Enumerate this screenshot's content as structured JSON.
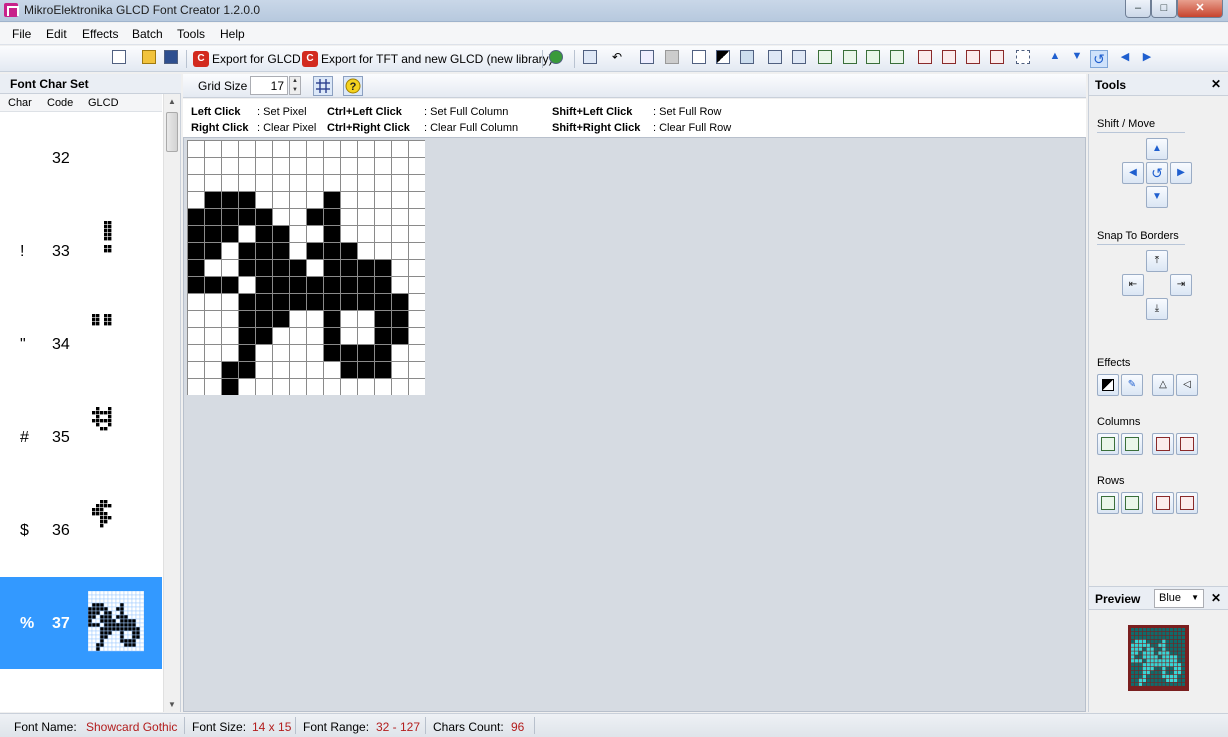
{
  "window": {
    "title": "MikroElektronika GLCD Font Creator 1.2.0.0"
  },
  "menu": {
    "items": [
      "File",
      "Edit",
      "Effects",
      "Batch",
      "Tools",
      "Help"
    ]
  },
  "toolbar": {
    "export_glcd": "Export for GLCD",
    "export_tft": "Export for TFT and new GLCD (new library)"
  },
  "charset": {
    "title": "Font Char Set",
    "col_char": "Char",
    "col_code": "Code",
    "col_glcd": "GLCD",
    "rows": [
      {
        "char": "",
        "code": "32"
      },
      {
        "char": "!",
        "code": "33"
      },
      {
        "char": "\"",
        "code": "34"
      },
      {
        "char": "#",
        "code": "35"
      },
      {
        "char": "$",
        "code": "36"
      },
      {
        "char": "%",
        "code": "37"
      }
    ],
    "selected_code": "37"
  },
  "gridbar": {
    "label": "Grid Size",
    "value": "17"
  },
  "hints": [
    {
      "key": "Left Click",
      "action": ": Set Pixel"
    },
    {
      "key": "Right Click",
      "action": ": Clear Pixel"
    },
    {
      "key": "Ctrl+Left Click",
      "action": ": Set Full Column"
    },
    {
      "key": "Ctrl+Right Click",
      "action": ": Clear Full Column"
    },
    {
      "key": "Shift+Left Click",
      "action": ": Set Full Row"
    },
    {
      "key": "Shift+Right Click",
      "action": ": Clear Full Row"
    }
  ],
  "editor": {
    "columns": 14,
    "rows": 15,
    "pixels": [
      "00000000000000",
      "00000000000000",
      "00000000000000",
      "01110000100000",
      "11111001100000",
      "11101100100000",
      "11011101110000",
      "10011110111100",
      "11101111111100",
      "00011111111110",
      "00011100100110",
      "00011000100110",
      "00010000111100",
      "00110000011100",
      "00100000000000"
    ]
  },
  "tools": {
    "title": "Tools",
    "shift_move": "Shift / Move",
    "snap_borders": "Snap To Borders",
    "effects": "Effects",
    "columns": "Columns",
    "rows": "Rows"
  },
  "preview": {
    "title": "Preview",
    "color": "Blue"
  },
  "status": {
    "font_name_label": "Font Name:",
    "font_name": "Showcard Gothic",
    "font_size_label": "Font Size:",
    "font_size": "14 x 15",
    "font_range_label": "Font Range:",
    "font_range": "32 - 127",
    "chars_count_label": "Chars Count:",
    "chars_count": "96"
  },
  "colors": {
    "accent": "#3399ff",
    "status_value": "#b31d1d",
    "preview_bg": "#7a1f1f",
    "preview_on": "#36d6d6"
  }
}
